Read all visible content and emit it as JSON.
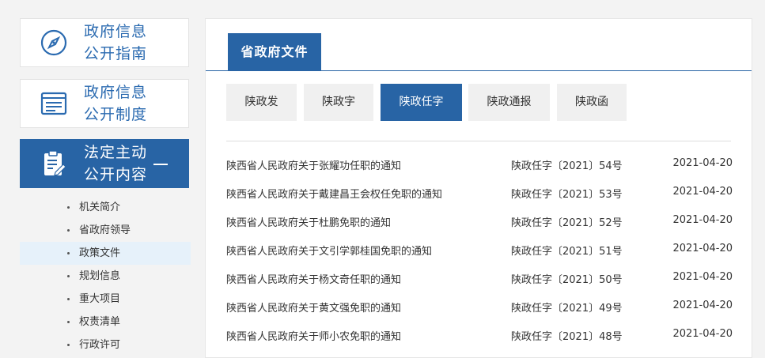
{
  "sidebar": {
    "cards": [
      {
        "line1": "政府信息",
        "line2": "公开指南"
      },
      {
        "line1": "政府信息",
        "line2": "公开制度"
      },
      {
        "line1": "法定主动",
        "line2": "公开内容"
      }
    ],
    "sub_items": [
      "机关简介",
      "省政府领导",
      "政策文件",
      "规划信息",
      "重大项目",
      "权责清单",
      "行政许可"
    ],
    "active_sub_index": 2
  },
  "panel": {
    "title": "省政府文件",
    "subtabs": [
      "陕政发",
      "陕政字",
      "陕政任字",
      "陕政通报",
      "陕政函"
    ],
    "active_subtab_index": 2,
    "rows": [
      {
        "title": "陕西省人民政府关于张耀功任职的通知",
        "number": "陕政任字〔2021〕54号",
        "date": "2021-04-20"
      },
      {
        "title": "陕西省人民政府关于戴建昌王会权任免职的通知",
        "number": "陕政任字〔2021〕53号",
        "date": "2021-04-20"
      },
      {
        "title": "陕西省人民政府关于杜鹏免职的通知",
        "number": "陕政任字〔2021〕52号",
        "date": "2021-04-20"
      },
      {
        "title": "陕西省人民政府关于文引学郭桂国免职的通知",
        "number": "陕政任字〔2021〕51号",
        "date": "2021-04-20"
      },
      {
        "title": "陕西省人民政府关于杨文奇任职的通知",
        "number": "陕政任字〔2021〕50号",
        "date": "2021-04-20"
      },
      {
        "title": "陕西省人民政府关于黄文强免职的通知",
        "number": "陕政任字〔2021〕49号",
        "date": "2021-04-20"
      },
      {
        "title": "陕西省人民政府关于师小农免职的通知",
        "number": "陕政任字〔2021〕48号",
        "date": "2021-04-20"
      }
    ]
  },
  "colors": {
    "brand": "#2864a5",
    "active_bg": "#e6f1fa",
    "tab_bg": "#f0f0f0"
  },
  "icons": [
    "compass-icon",
    "document-list-icon",
    "clipboard-edit-icon",
    "minus-icon"
  ]
}
